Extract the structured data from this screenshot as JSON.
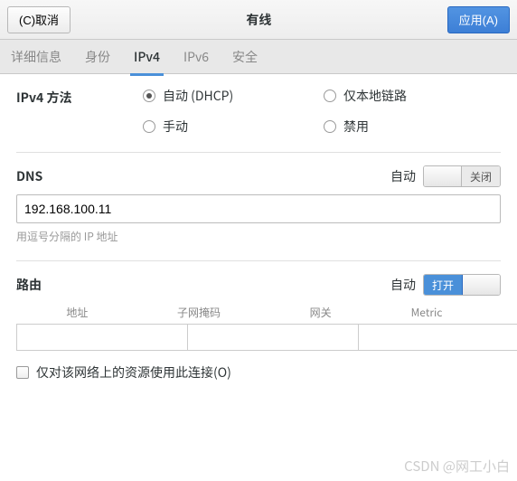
{
  "titlebar": {
    "cancel": "(C)取消",
    "title": "有线",
    "apply": "应用(A)"
  },
  "tabs": [
    "详细信息",
    "身份",
    "IPv4",
    "IPv6",
    "安全"
  ],
  "active_tab": 2,
  "method": {
    "label": "IPv4 方法",
    "options": [
      "自动 (DHCP)",
      "仅本地链路",
      "手动",
      "禁用"
    ],
    "selected": 0
  },
  "dns": {
    "label": "DNS",
    "auto_label": "自动",
    "switch_state": "off",
    "switch_text": "关闭",
    "value": "192.168.100.11",
    "hint": "用逗号分隔的 IP 地址"
  },
  "routes": {
    "label": "路由",
    "auto_label": "自动",
    "switch_state": "on",
    "switch_text": "打开",
    "columns": [
      "地址",
      "子网掩码",
      "网关",
      "Metric"
    ],
    "row": {
      "addr": "",
      "mask": "",
      "gw": "",
      "metric": ""
    },
    "only_local": "仅对该网络上的资源使用此连接(O)"
  },
  "watermark": "CSDN @网工小白"
}
